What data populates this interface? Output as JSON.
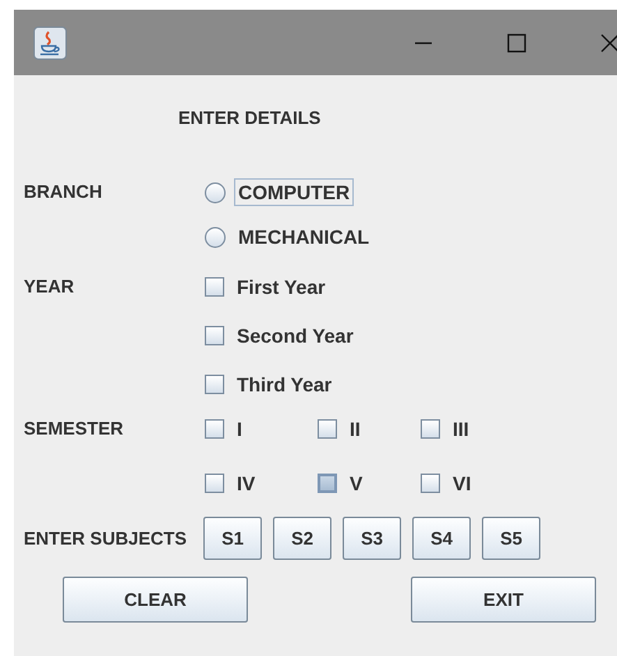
{
  "heading": "ENTER DETAILS",
  "branch": {
    "label": "BRANCH",
    "options": [
      {
        "label": "COMPUTER",
        "selected": false,
        "focused": true
      },
      {
        "label": "MECHANICAL",
        "selected": false,
        "focused": false
      }
    ]
  },
  "year": {
    "label": "YEAR",
    "options": [
      {
        "label": "First Year",
        "checked": false
      },
      {
        "label": "Second Year",
        "checked": false
      },
      {
        "label": "Third Year",
        "checked": false
      }
    ]
  },
  "semester": {
    "label": "SEMESTER",
    "options": [
      {
        "label": "I",
        "checked": false,
        "hovered": false
      },
      {
        "label": "II",
        "checked": false,
        "hovered": false
      },
      {
        "label": "III",
        "checked": false,
        "hovered": false
      },
      {
        "label": "IV",
        "checked": false,
        "hovered": false
      },
      {
        "label": "V",
        "checked": false,
        "hovered": true
      },
      {
        "label": "VI",
        "checked": false,
        "hovered": false
      }
    ]
  },
  "subjects": {
    "label": "ENTER SUBJECTS",
    "buttons": [
      "S1",
      "S2",
      "S3",
      "S4",
      "S5"
    ]
  },
  "buttons": [
    "CLEAR",
    "EXIT"
  ]
}
